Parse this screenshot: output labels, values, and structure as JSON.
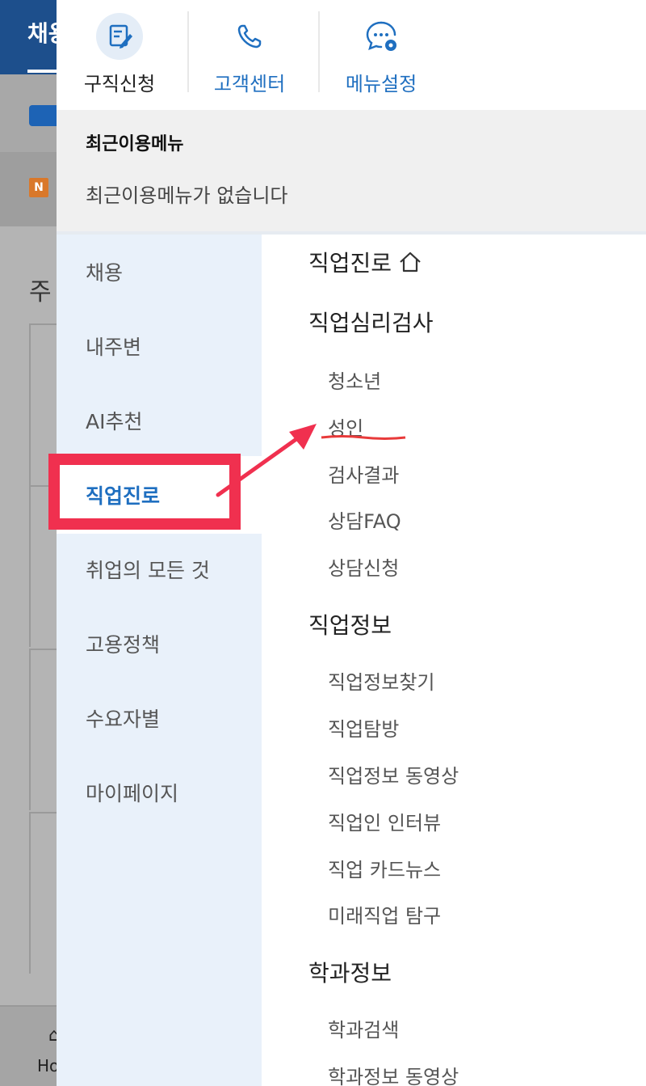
{
  "background": {
    "header_partial": "채용",
    "n_badge": "N",
    "section_title_partial": "주",
    "bottom_nav_icon": "home-icon",
    "bottom_nav_partial": "Ho"
  },
  "quick_menu": [
    {
      "label": "구직신청",
      "icon": "edit-document-icon"
    },
    {
      "label": "고객센터",
      "icon": "phone-icon"
    },
    {
      "label": "메뉴설정",
      "icon": "chat-gear-icon"
    }
  ],
  "recent": {
    "title": "최근이용메뉴",
    "empty_message": "최근이용메뉴가 없습니다"
  },
  "left_nav": {
    "items": [
      "채용",
      "내주변",
      "AI추천",
      "직업진로",
      "취업의 모든 것",
      "고용정책",
      "수요자별",
      "마이페이지"
    ],
    "active": "직업진로"
  },
  "content": {
    "main_title": "직업진로",
    "sections": [
      {
        "title": "직업심리검사",
        "items": [
          "청소년",
          "성인",
          "검사결과",
          "상담FAQ",
          "상담신청"
        ]
      },
      {
        "title": "직업정보",
        "items": [
          "직업정보찾기",
          "직업탐방",
          "직업정보 동영상",
          "직업인 인터뷰",
          "직업 카드뉴스",
          "미래직업 탐구"
        ]
      },
      {
        "title": "학과정보",
        "items": [
          "학과검색",
          "학과정보 동영상"
        ]
      }
    ]
  },
  "colors": {
    "accent_blue": "#1f6fc0",
    "annotation_red": "#f0304f",
    "nav_bg": "#e9f1fa"
  }
}
